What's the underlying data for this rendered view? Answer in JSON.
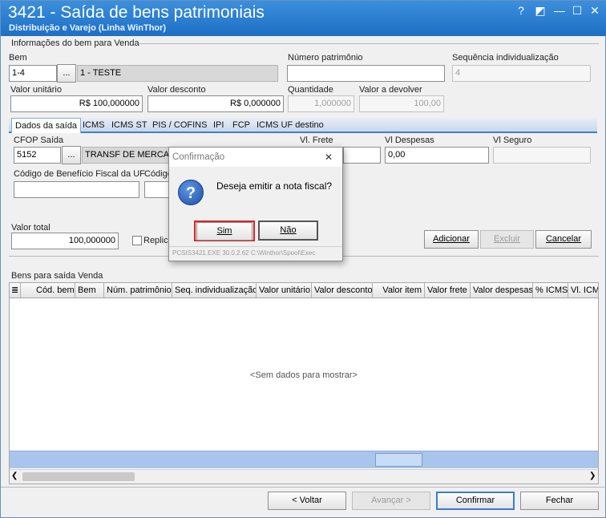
{
  "window": {
    "title": "3421 - Saída de bens patrimoniais",
    "subtitle": "Distribuição e Varejo (Linha WinThor)",
    "controls": [
      "?",
      "◩",
      "—",
      "☐",
      "✕"
    ]
  },
  "bem_section": {
    "group_label": "Informações do bem para Venda",
    "bem_label": "Bem",
    "bem_code": "1-4",
    "bem_lookup": "...",
    "bem_desc": "1 - TESTE",
    "numero_patrimonio_label": "Número patrimônio",
    "numero_patrimonio": "",
    "sequencia_label": "Sequência individualização",
    "sequencia": "4",
    "valor_unitario_label": "Valor unitário",
    "valor_unitario": "R$ 100,000000",
    "valor_desconto_label": "Valor desconto",
    "valor_desconto": "R$ 0,000000",
    "quantidade_label": "Quantidade",
    "quantidade": "1,000000",
    "valor_devolver_label": "Valor a devolver",
    "valor_devolver": "100,00"
  },
  "tabs": [
    {
      "label": "Dados da saída",
      "active": true
    },
    {
      "label": "ICMS"
    },
    {
      "label": "ICMS ST"
    },
    {
      "label": "PIS / COFINS"
    },
    {
      "label": "IPI"
    },
    {
      "label": "FCP"
    },
    {
      "label": "ICMS UF destino"
    }
  ],
  "saida": {
    "cfop_label": "CFOP Saída",
    "cfop_code": "5152",
    "cfop_lookup": "...",
    "cfop_desc": "TRANSF DE MERCADO",
    "vl_frete_label": "Vl. Frete",
    "vl_despesas_label": "Vl Despesas",
    "vl_despesas": "0,00",
    "vl_seguro_label": "Vl Seguro",
    "cod_beneficio_label": "Código de Benefício Fiscal da UF",
    "codigo_label_2": "Código",
    "valor_total_label": "Valor total",
    "valor_total": "100,000000",
    "replicar_label": "Replica"
  },
  "actions": {
    "adicionar": "Adicionar",
    "excluir": "Excluir",
    "cancelar": "Cancelar"
  },
  "grid": {
    "group_label": "Bens para saída Venda",
    "columns": [
      "Cód. bem",
      "Bem",
      "Núm. patrimônio",
      "Seq. individualização",
      "Valor unitário",
      "Valor desconto",
      "Valor item",
      "Valor frete",
      "Valor despesas",
      "% ICMS",
      "Vl. ICMS"
    ],
    "empty_text": "<Sem dados para mostrar>"
  },
  "footer": {
    "voltar": "< Voltar",
    "avancar": "Avançar >",
    "confirmar": "Confirmar",
    "fechar": "Fechar"
  },
  "dialog": {
    "title": "Confirmação",
    "close": "✕",
    "message": "Deseja emitir a nota fiscal?",
    "icon": "question-icon",
    "yes": "Sim",
    "no": "Não",
    "footer": "PCSIS3421.EXE 30.0.2.62 C:\\Winthor\\Spool\\Exec"
  }
}
